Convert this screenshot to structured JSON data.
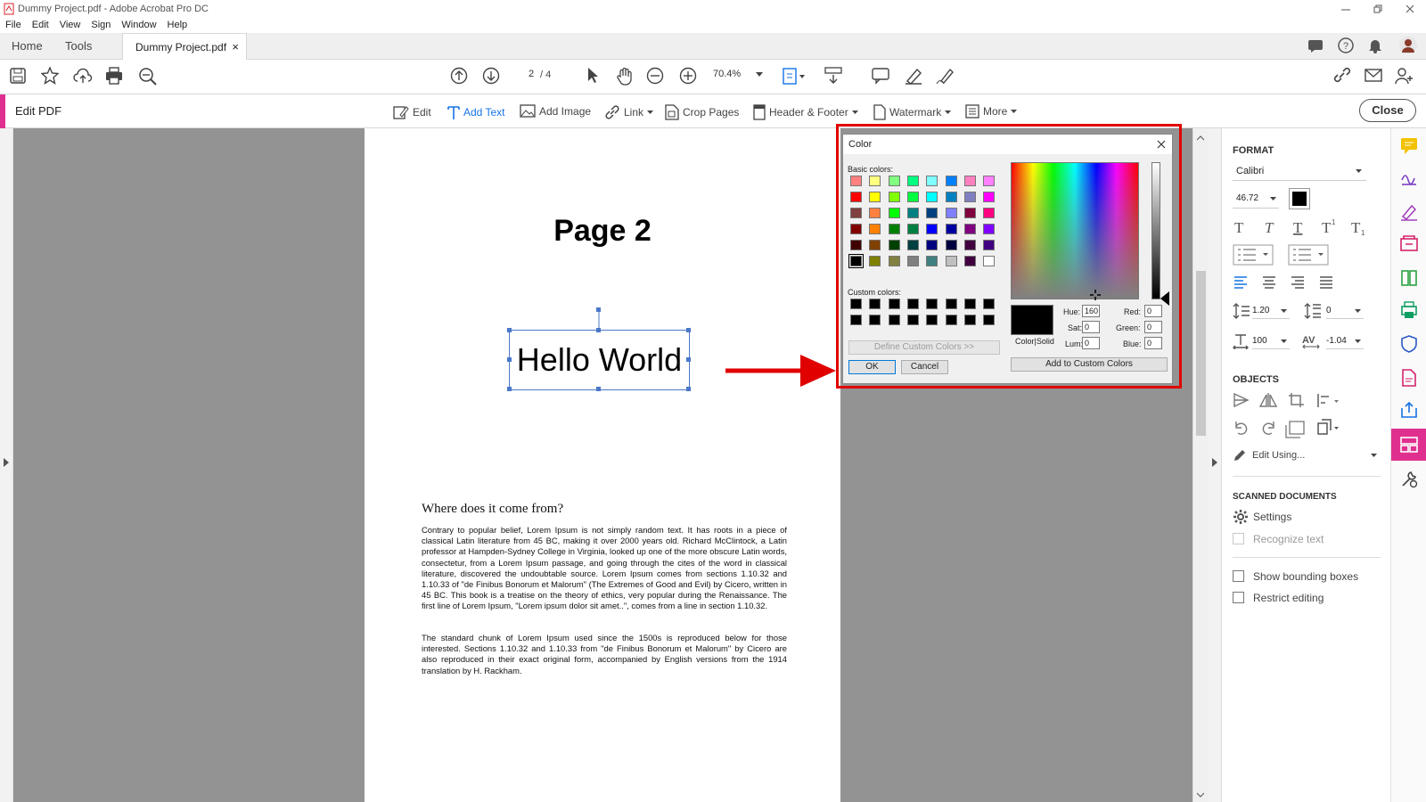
{
  "window": {
    "title": "Dummy Project.pdf - Adobe Acrobat Pro DC"
  },
  "menu": [
    "File",
    "Edit",
    "View",
    "Sign",
    "Window",
    "Help"
  ],
  "tabs": {
    "home": "Home",
    "tools": "Tools",
    "document": "Dummy Project.pdf",
    "close_glyph": "×"
  },
  "toolbar": {
    "page_current": "2",
    "page_total": "/ 4",
    "zoom": "70.4%"
  },
  "editbar": {
    "title": "Edit PDF",
    "edit": "Edit",
    "add_text": "Add Text",
    "add_image": "Add Image",
    "link": "Link",
    "crop": "Crop Pages",
    "header_footer": "Header & Footer",
    "watermark": "Watermark",
    "more": "More",
    "close": "Close"
  },
  "page": {
    "heading": "Page 2",
    "textbox": "Hello World",
    "section_title": "Where does it come from?",
    "para1": "Contrary to popular belief, Lorem Ipsum is not simply random text. It has roots in a piece of classical Latin literature from 45 BC, making it over 2000 years old. Richard McClintock, a Latin professor at Hampden-Sydney College in Virginia, looked up one of the more obscure Latin words, consectetur, from a Lorem Ipsum passage, and going through the cites of the word in classical literature, discovered the undoubtable source. Lorem Ipsum comes from sections 1.10.32 and 1.10.33 of \"de Finibus Bonorum et Malorum\" (The Extremes of Good and Evil) by Cicero, written in 45 BC. This book is a treatise on the theory of ethics, very popular during the Renaissance. The first line of Lorem Ipsum, \"Lorem ipsum dolor sit amet..\", comes from a line in section 1.10.32.",
    "para2": "The standard chunk of Lorem Ipsum used since the 1500s is reproduced below for those interested. Sections 1.10.32 and 1.10.33 from \"de Finibus Bonorum et Malorum\" by Cicero are also reproduced in their exact original form, accompanied by English versions from the 1914 translation by H. Rackham."
  },
  "color_dialog": {
    "title": "Color",
    "basic_label": "Basic colors:",
    "custom_label": "Custom colors:",
    "define_btn": "Define Custom Colors >>",
    "ok": "OK",
    "cancel": "Cancel",
    "add_custom": "Add to Custom Colors",
    "color_solid": "Color|Solid",
    "hue_label": "Hue:",
    "hue": "160",
    "sat_label": "Sat:",
    "sat": "0",
    "lum_label": "Lum:",
    "lum": "0",
    "red_label": "Red:",
    "red": "0",
    "green_label": "Green:",
    "green": "0",
    "blue_label": "Blue:",
    "blue": "0",
    "basic_colors": [
      "#ff8080",
      "#ffff80",
      "#80ff80",
      "#00ff80",
      "#80ffff",
      "#0080ff",
      "#ff80c0",
      "#ff80ff",
      "#ff0000",
      "#ffff00",
      "#80ff00",
      "#00ff40",
      "#00ffff",
      "#0080c0",
      "#8080c0",
      "#ff00ff",
      "#804040",
      "#ff8040",
      "#00ff00",
      "#008080",
      "#004080",
      "#8080ff",
      "#800040",
      "#ff0080",
      "#800000",
      "#ff8000",
      "#008000",
      "#008040",
      "#0000ff",
      "#0000a0",
      "#800080",
      "#8000ff",
      "#400000",
      "#804000",
      "#004000",
      "#004040",
      "#000080",
      "#000040",
      "#400040",
      "#400080",
      "#000000",
      "#808000",
      "#808040",
      "#808080",
      "#408080",
      "#c0c0c0",
      "#400040",
      "#ffffff"
    ],
    "custom_colors": [
      "#000000",
      "#000000",
      "#000000",
      "#000000",
      "#000000",
      "#000000",
      "#000000",
      "#000000",
      "#000000",
      "#000000",
      "#000000",
      "#000000",
      "#000000",
      "#000000",
      "#000000",
      "#000000"
    ],
    "selected_color": "#000000"
  },
  "format_panel": {
    "format_title": "FORMAT",
    "font": "Calibri",
    "font_size": "46.72",
    "text_color": "#000000",
    "line_spacing": "1.20",
    "para_spacing": "0",
    "horiz_scale": "100",
    "char_spacing": "-1.04",
    "objects_title": "OBJECTS",
    "edit_using": "Edit Using...",
    "scanned_title": "SCANNED DOCUMENTS",
    "settings": "Settings",
    "recognize": "Recognize text",
    "show_bbox": "Show bounding boxes",
    "restrict": "Restrict editing"
  },
  "colors": {
    "accent": "#e0308f",
    "annotation_red": "#e00000",
    "link_blue": "#1473e6"
  }
}
